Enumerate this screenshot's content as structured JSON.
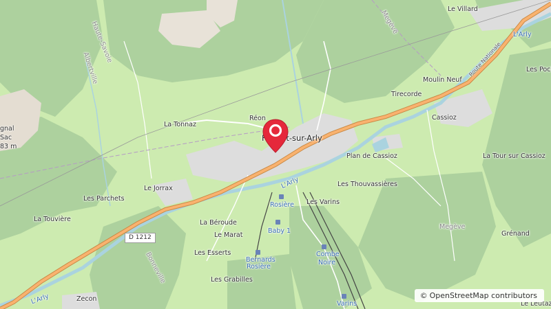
{
  "map": {
    "labels": {
      "le_villard": "Le Villard",
      "haute_savoie": "Haute-Savoie",
      "albertville": "Albertville",
      "megeve_top": "Megève",
      "larly_ne": "L'Arly",
      "route_nationale": "Route Nationale",
      "les_pock": "Les Pock",
      "moulin_neuf": "Moulin Neuf",
      "tirecorde": "Tirecorde",
      "cassioz": "Cassioz",
      "gnal": "gnal",
      "sac": "Sac",
      "alt": "83 m",
      "reon": "Réon",
      "la_tonnaz": "La Tonnaz",
      "town": "Flumet-sur-Arly",
      "plan_de_cassioz": "Plan de Cassioz",
      "la_tour_sur_cassioz": "La Tour sur Cassioz",
      "le_jorrax": "Le Jorrax",
      "les_thouvassieres": "Les Thouvassières",
      "larly_mid": "L'Arly",
      "les_parchets": "Les Parchets",
      "rosiere": "Rosière",
      "les_varins": "Les Varins",
      "la_touviere": "La Touvière",
      "la_beroude": "La Béroude",
      "baby1": "Baby 1",
      "d1212": "D 1212",
      "le_marat": "Le Marat",
      "megeve_bottom": "Megève",
      "grenand": "Grénand",
      "les_esserts": "Les Esserts",
      "combe_noire_1": "Combe",
      "combe_noire_2": "Noire",
      "bonneville": "Bonneville",
      "bernards_1": "Bernards",
      "bernards_2": "Rosière",
      "les_grabilles": "Les Grabilles",
      "larly_sw": "L'Arly",
      "zecon": "Zecon",
      "varins": "Varins",
      "le_leutaz": "Le Leutaz"
    },
    "attribution": {
      "symbol": "©",
      "text": "OpenStreetMap contributors"
    },
    "marker": {
      "icon": "map-pin-icon"
    },
    "colors": {
      "forest": "#add19e",
      "meadow": "#cdebb0",
      "water": "#aad3df",
      "road_major": "#f9b26f",
      "residential": "#dddddd",
      "marker": "#e5283b"
    }
  }
}
